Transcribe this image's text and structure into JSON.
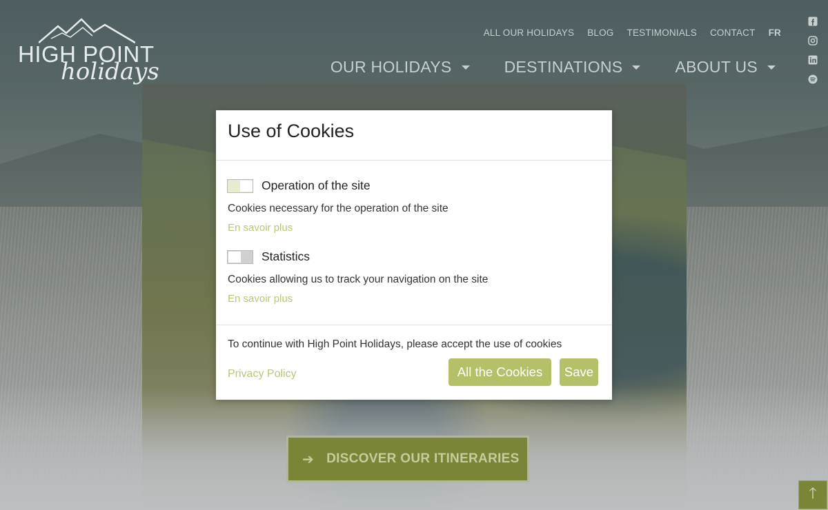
{
  "header": {
    "logo": {
      "line1": "HIGH POINT",
      "line2": "holidays"
    },
    "top_links": [
      "ALL OUR HOLIDAYS",
      "BLOG",
      "TESTIMONIALS",
      "CONTACT"
    ],
    "lang": "FR",
    "nav": [
      "OUR HOLIDAYS",
      "DESTINATIONS",
      "ABOUT US"
    ],
    "social_icons": [
      "facebook-icon",
      "instagram-icon",
      "linkedin-icon",
      "spotify-icon"
    ]
  },
  "hero": {
    "cta_label": "DISCOVER OUR ITINERARIES",
    "cta_icon": "arrow-right-icon",
    "scroll_top_icon": "arrow-up-icon"
  },
  "cookie_modal": {
    "title": "Use of Cookies",
    "options": [
      {
        "title": "Operation of the site",
        "description": "Cookies necessary for the operation of the site",
        "link": "En savoir plus",
        "enabled": true
      },
      {
        "title": "Statistics",
        "description": "Cookies allowing us to track your navigation on the site",
        "link": "En savoir plus",
        "enabled": false
      }
    ],
    "footer_text": "To continue with High Point Holidays, please accept the use of cookies",
    "privacy_link": "Privacy Policy",
    "accept_all_label": "All the Cookies",
    "save_label": "Save"
  },
  "colors": {
    "accent": "#b6c068",
    "link": "#bcc47a",
    "cta_bg": "#7a8537"
  }
}
